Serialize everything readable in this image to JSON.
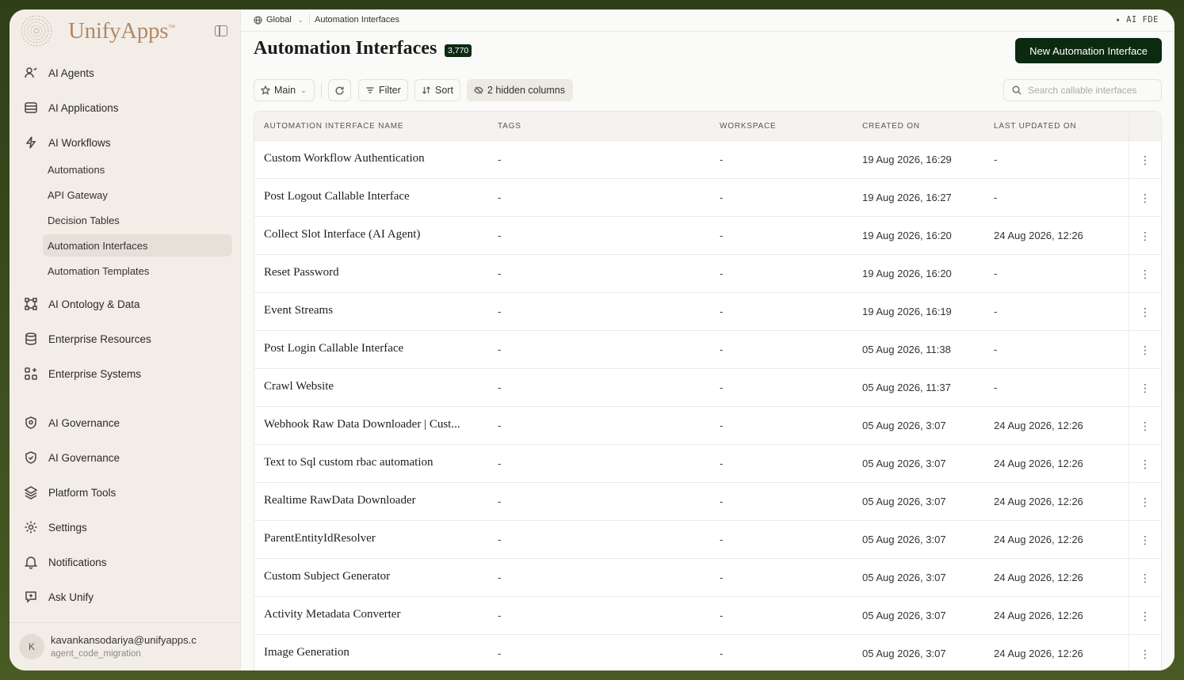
{
  "sidebar": {
    "logo_text": "UnifyApps",
    "logo_tm": "™",
    "items": [
      {
        "label": "AI Agents",
        "icon": "agent-icon"
      },
      {
        "label": "AI Applications",
        "icon": "applications-icon"
      },
      {
        "label": "AI Workflows",
        "icon": "lightning-icon"
      },
      {
        "label": "AI Ontology & Data",
        "icon": "ontology-icon"
      },
      {
        "label": "Enterprise Resources",
        "icon": "database-icon"
      },
      {
        "label": "Enterprise Systems",
        "icon": "systems-icon"
      },
      {
        "label": "AI Governance",
        "icon": "shield-icon"
      },
      {
        "label": "AI Governance",
        "icon": "shield-check-icon"
      },
      {
        "label": "Platform Tools",
        "icon": "layers-icon"
      },
      {
        "label": "Settings",
        "icon": "gear-icon"
      },
      {
        "label": "Notifications",
        "icon": "bell-icon"
      },
      {
        "label": "Ask Unify",
        "icon": "chat-icon"
      }
    ],
    "workflow_subitems": [
      {
        "label": "Automations"
      },
      {
        "label": "API Gateway"
      },
      {
        "label": "Decision Tables"
      },
      {
        "label": "Automation Interfaces",
        "active": true
      },
      {
        "label": "Automation Templates"
      }
    ],
    "user": {
      "initial": "K",
      "email": "kavankansodariya@unifyapps.c",
      "org": "agent_code_migration"
    }
  },
  "topbar": {
    "scope": "Global",
    "page": "Automation Interfaces",
    "ai_fde": "✦ AI FDE"
  },
  "header": {
    "title": "Automation Interfaces",
    "count": "3,770",
    "new_button": "New Automation Interface"
  },
  "toolbar": {
    "view": "Main",
    "filter": "Filter",
    "sort": "Sort",
    "hidden_columns": "2 hidden columns",
    "search_placeholder": "Search callable interfaces"
  },
  "table": {
    "columns": [
      "AUTOMATION INTERFACE NAME",
      "TAGS",
      "WORKSPACE",
      "CREATED ON",
      "LAST UPDATED ON"
    ],
    "rows": [
      {
        "name": "Custom Workflow Authentication",
        "tags": "-",
        "workspace": "-",
        "created": "19 Aug 2026, 16:29",
        "updated": "-"
      },
      {
        "name": "Post Logout Callable Interface",
        "tags": "-",
        "workspace": "-",
        "created": "19 Aug 2026, 16:27",
        "updated": "-"
      },
      {
        "name": "Collect Slot Interface (AI Agent)",
        "tags": "-",
        "workspace": "-",
        "created": "19 Aug 2026, 16:20",
        "updated": "24 Aug 2026, 12:26"
      },
      {
        "name": "Reset Password",
        "tags": "-",
        "workspace": "-",
        "created": "19 Aug 2026, 16:20",
        "updated": "-"
      },
      {
        "name": "Event Streams",
        "tags": "-",
        "workspace": "-",
        "created": "19 Aug 2026, 16:19",
        "updated": "-"
      },
      {
        "name": "Post Login Callable Interface",
        "tags": "-",
        "workspace": "-",
        "created": "05 Aug 2026, 11:38",
        "updated": "-"
      },
      {
        "name": "Crawl Website",
        "tags": "-",
        "workspace": "-",
        "created": "05 Aug 2026, 11:37",
        "updated": "-"
      },
      {
        "name": "Webhook Raw Data Downloader | Cust...",
        "tags": "-",
        "workspace": "-",
        "created": "05 Aug 2026, 3:07",
        "updated": "24 Aug 2026, 12:26"
      },
      {
        "name": "Text to Sql custom rbac automation",
        "tags": "-",
        "workspace": "-",
        "created": "05 Aug 2026, 3:07",
        "updated": "24 Aug 2026, 12:26"
      },
      {
        "name": "Realtime RawData Downloader",
        "tags": "-",
        "workspace": "-",
        "created": "05 Aug 2026, 3:07",
        "updated": "24 Aug 2026, 12:26"
      },
      {
        "name": "ParentEntityIdResolver",
        "tags": "-",
        "workspace": "-",
        "created": "05 Aug 2026, 3:07",
        "updated": "24 Aug 2026, 12:26"
      },
      {
        "name": "Custom Subject Generator",
        "tags": "-",
        "workspace": "-",
        "created": "05 Aug 2026, 3:07",
        "updated": "24 Aug 2026, 12:26"
      },
      {
        "name": "Activity Metadata Converter",
        "tags": "-",
        "workspace": "-",
        "created": "05 Aug 2026, 3:07",
        "updated": "24 Aug 2026, 12:26"
      },
      {
        "name": "Image Generation",
        "tags": "-",
        "workspace": "-",
        "created": "05 Aug 2026, 3:07",
        "updated": "24 Aug 2026, 12:26"
      }
    ],
    "row_action_icon": "⋮"
  },
  "colors": {
    "accent": "#0b2a10",
    "sidebar_bg": "#f3ede7",
    "logo": "#b08a66"
  }
}
